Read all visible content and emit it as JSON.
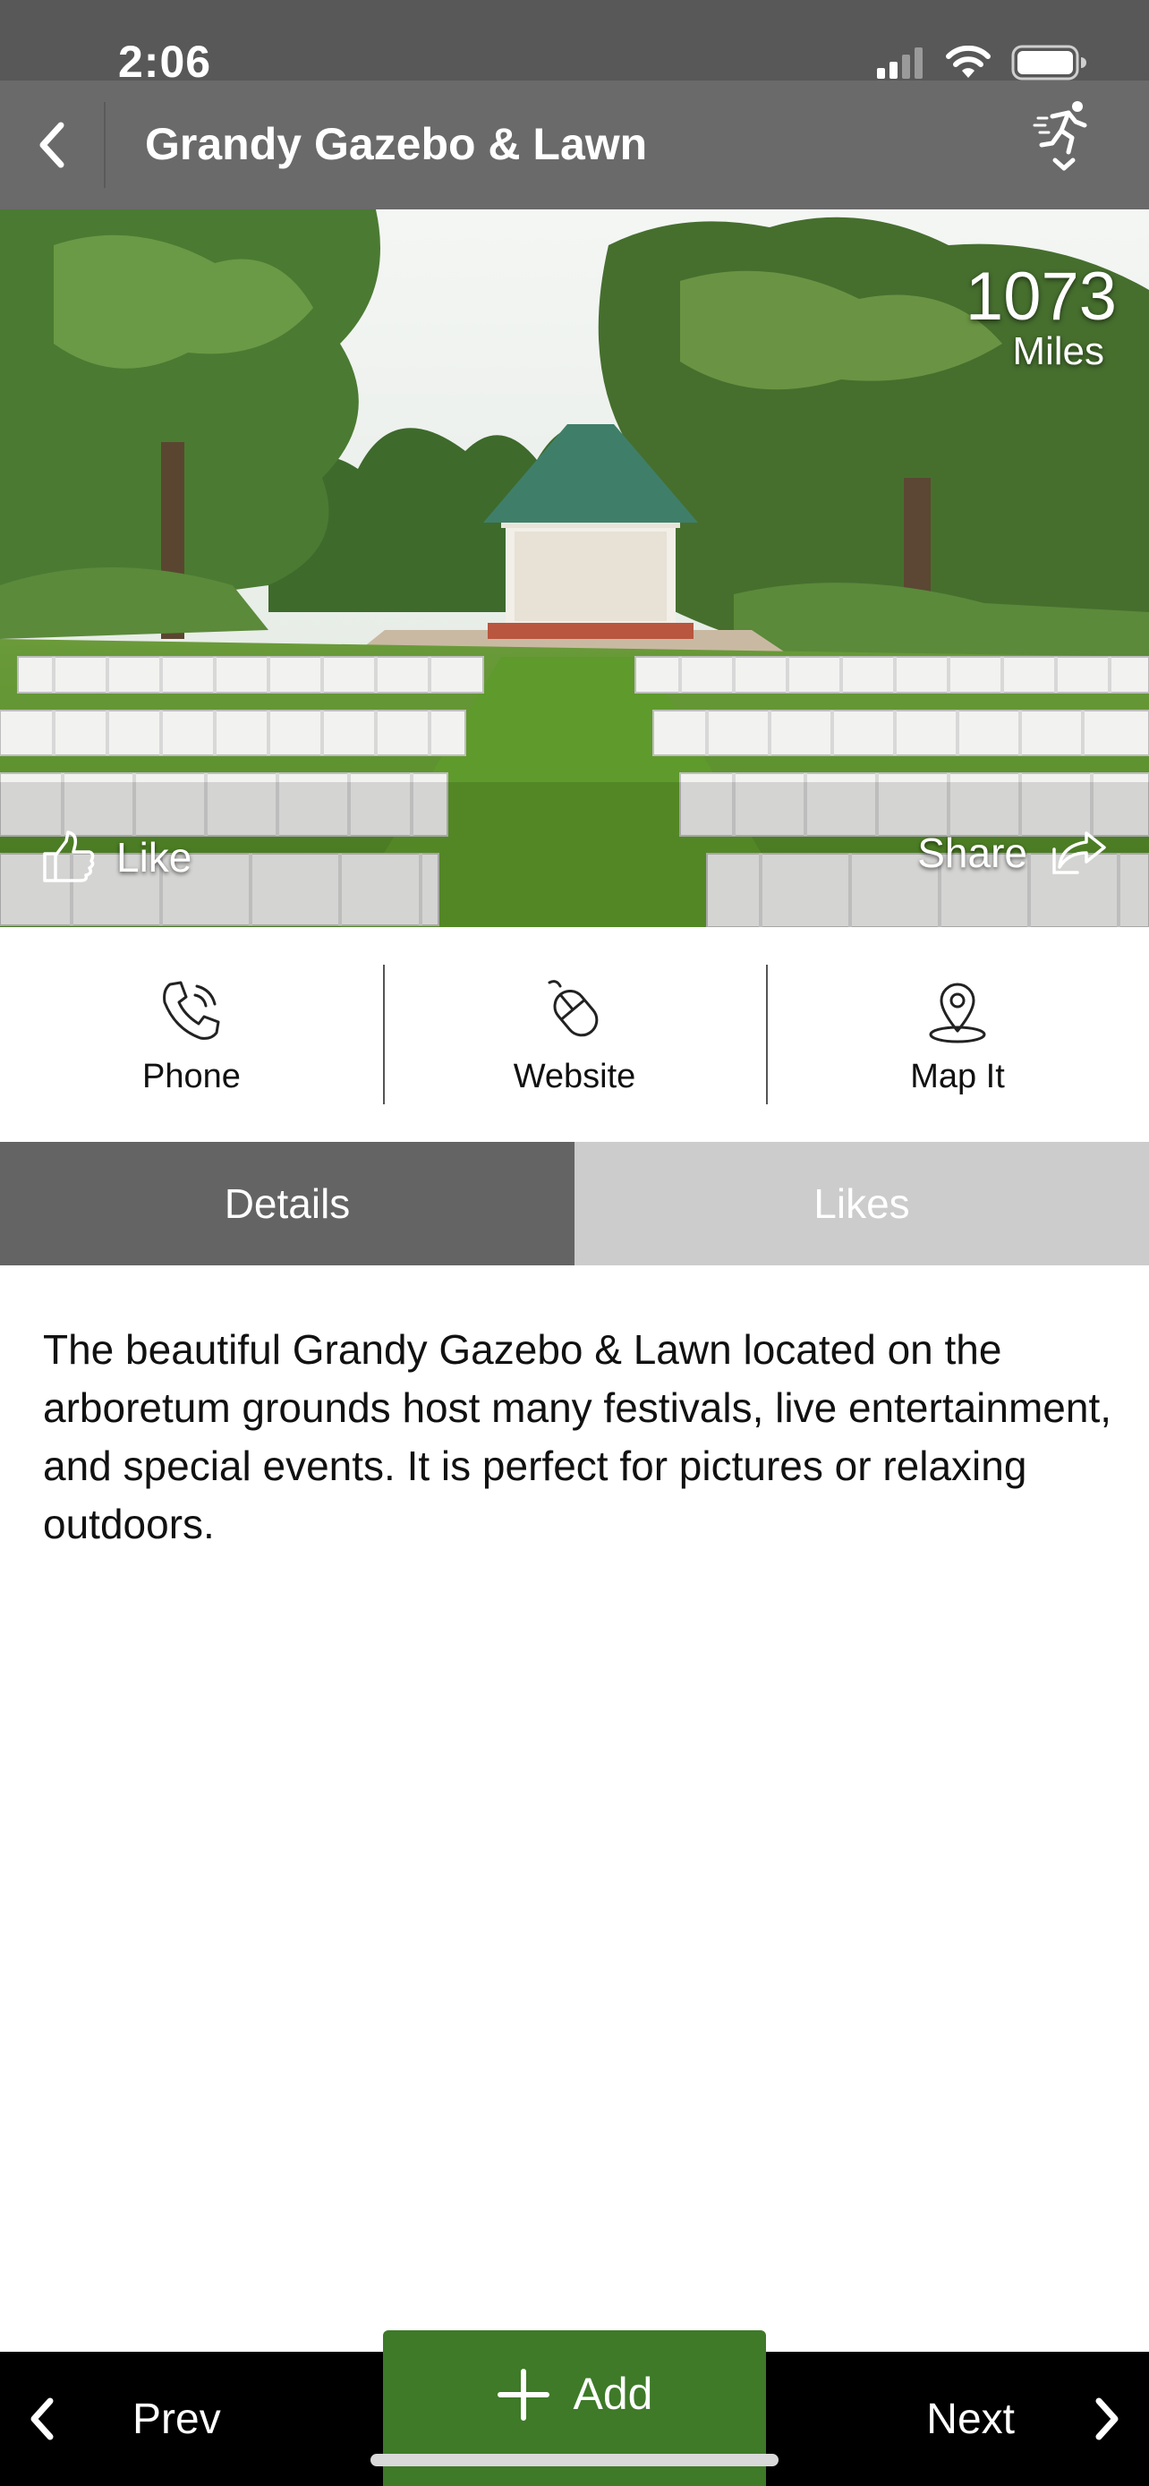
{
  "status_bar": {
    "time": "2:06",
    "icons": [
      "signal-icon",
      "wifi-icon",
      "battery-icon"
    ]
  },
  "header": {
    "title": "Grandy Gazebo & Lawn",
    "back_icon": "chevron-left-icon",
    "action_icon": "runner-icon"
  },
  "hero": {
    "distance_value": "1073",
    "distance_unit": "Miles",
    "like_label": "Like",
    "share_label": "Share"
  },
  "actions": [
    {
      "label": "Phone",
      "icon": "phone-icon"
    },
    {
      "label": "Website",
      "icon": "mouse-icon"
    },
    {
      "label": "Map It",
      "icon": "map-pin-icon"
    }
  ],
  "tabs": [
    {
      "label": "Details",
      "active": true
    },
    {
      "label": "Likes",
      "active": false
    }
  ],
  "description": "The beautiful Grandy Gazebo & Lawn located on the arboretum grounds host many festivals, live entertainment, and special events. It is perfect for pictures or relaxing outdoors.",
  "bottom_bar": {
    "prev_label": "Prev",
    "add_label": "Add",
    "next_label": "Next"
  },
  "colors": {
    "header": "#6a6a6a",
    "status_bar": "#585858",
    "tab_active": "#646464",
    "tab_inactive": "#cccccc",
    "add_button": "#3e7a28",
    "bottom_bar": "#000000"
  }
}
